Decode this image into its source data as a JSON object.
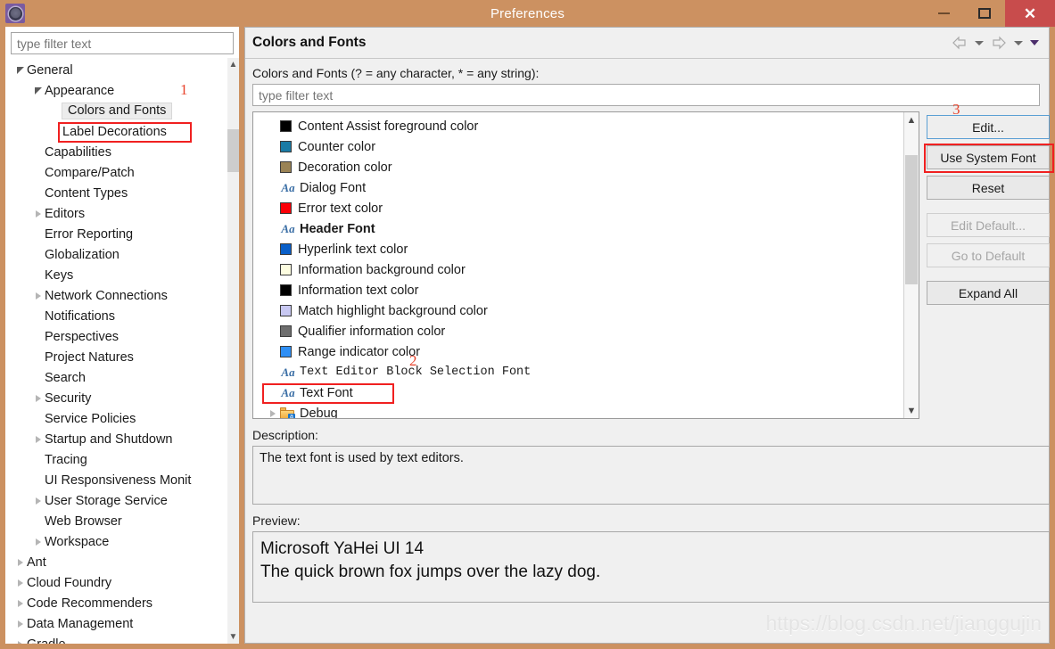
{
  "window": {
    "title": "Preferences",
    "app_icon": "gear-icon",
    "minimize_label": "–",
    "maximize_label": "☐",
    "close_label": "✕"
  },
  "sidebar": {
    "filter_placeholder": "type filter text",
    "filter_value": "",
    "items": [
      {
        "label": "General",
        "indent": 0,
        "twisty": "expanded"
      },
      {
        "label": "Appearance",
        "indent": 1,
        "twisty": "expanded"
      },
      {
        "label": "Colors and Fonts",
        "indent": 2,
        "twisty": "none",
        "selected": true
      },
      {
        "label": "Label Decorations",
        "indent": 2,
        "twisty": "none",
        "highlight": "red"
      },
      {
        "label": "Capabilities",
        "indent": 1,
        "twisty": "none"
      },
      {
        "label": "Compare/Patch",
        "indent": 1,
        "twisty": "none"
      },
      {
        "label": "Content Types",
        "indent": 1,
        "twisty": "none"
      },
      {
        "label": "Editors",
        "indent": 1,
        "twisty": "collapsed"
      },
      {
        "label": "Error Reporting",
        "indent": 1,
        "twisty": "none"
      },
      {
        "label": "Globalization",
        "indent": 1,
        "twisty": "none"
      },
      {
        "label": "Keys",
        "indent": 1,
        "twisty": "none"
      },
      {
        "label": "Network Connections",
        "indent": 1,
        "twisty": "collapsed"
      },
      {
        "label": "Notifications",
        "indent": 1,
        "twisty": "none"
      },
      {
        "label": "Perspectives",
        "indent": 1,
        "twisty": "none"
      },
      {
        "label": "Project Natures",
        "indent": 1,
        "twisty": "none"
      },
      {
        "label": "Search",
        "indent": 1,
        "twisty": "none"
      },
      {
        "label": "Security",
        "indent": 1,
        "twisty": "collapsed"
      },
      {
        "label": "Service Policies",
        "indent": 1,
        "twisty": "none"
      },
      {
        "label": "Startup and Shutdown",
        "indent": 1,
        "twisty": "collapsed"
      },
      {
        "label": "Tracing",
        "indent": 1,
        "twisty": "none"
      },
      {
        "label": "UI Responsiveness Monit",
        "indent": 1,
        "twisty": "none"
      },
      {
        "label": "User Storage Service",
        "indent": 1,
        "twisty": "collapsed"
      },
      {
        "label": "Web Browser",
        "indent": 1,
        "twisty": "none"
      },
      {
        "label": "Workspace",
        "indent": 1,
        "twisty": "collapsed"
      },
      {
        "label": "Ant",
        "indent": 0,
        "twisty": "collapsed"
      },
      {
        "label": "Cloud Foundry",
        "indent": 0,
        "twisty": "collapsed"
      },
      {
        "label": "Code Recommenders",
        "indent": 0,
        "twisty": "collapsed"
      },
      {
        "label": "Data Management",
        "indent": 0,
        "twisty": "collapsed"
      },
      {
        "label": "Gradle",
        "indent": 0,
        "twisty": "collapsed"
      }
    ]
  },
  "page": {
    "title": "Colors and Fonts",
    "filter_label": "Colors and Fonts (? = any character, * = any string):",
    "filter_placeholder": "type filter text",
    "filter_value": "",
    "nav": {
      "back_icon": "back-arrow-icon",
      "back_menu_icon": "chevron-down-icon",
      "forward_icon": "forward-arrow-icon",
      "forward_menu_icon": "chevron-down-icon",
      "overflow_menu_icon": "chevron-down-filled-icon"
    }
  },
  "color_list": [
    {
      "label": "Content Assist foreground color",
      "kind": "color",
      "color": "#000000"
    },
    {
      "label": "Counter color",
      "kind": "color",
      "color": "#1a7ba5"
    },
    {
      "label": "Decoration color",
      "kind": "color",
      "color": "#9a8355"
    },
    {
      "label": "Dialog Font",
      "kind": "font",
      "icon": "Aa"
    },
    {
      "label": "Error text color",
      "kind": "color",
      "color": "#fb0007"
    },
    {
      "label": "Header Font",
      "kind": "font",
      "icon": "Aa",
      "style": "bold"
    },
    {
      "label": "Hyperlink text color",
      "kind": "color",
      "color": "#0a5fc8"
    },
    {
      "label": "Information background color",
      "kind": "color",
      "color": "#fdfde0"
    },
    {
      "label": "Information text color",
      "kind": "color",
      "color": "#000000"
    },
    {
      "label": "Match highlight background color",
      "kind": "color",
      "color": "#c8c8f2"
    },
    {
      "label": "Qualifier information color",
      "kind": "color",
      "color": "#6e6e6e"
    },
    {
      "label": "Range indicator color",
      "kind": "color",
      "color": "#2f8ff5"
    },
    {
      "label": "Text Editor Block Selection Font",
      "kind": "font",
      "icon": "Aa",
      "style": "mono",
      "marker": "2"
    },
    {
      "label": "Text Font",
      "kind": "font",
      "icon": "Aa",
      "highlight": "red"
    },
    {
      "label": "Debug",
      "kind": "folder",
      "twisty": "collapsed"
    }
  ],
  "buttons": [
    {
      "label": "Edit...",
      "state": "focused",
      "marker": "3"
    },
    {
      "label": "Use System Font",
      "state": "normal",
      "highlight": "red"
    },
    {
      "label": "Reset",
      "state": "normal"
    },
    {
      "label": "Edit Default...",
      "state": "disabled",
      "gap": true
    },
    {
      "label": "Go to Default",
      "state": "disabled"
    },
    {
      "label": "Expand All",
      "state": "normal",
      "gap": true
    }
  ],
  "description": {
    "label": "Description:",
    "text": "The text font is used by text editors."
  },
  "preview": {
    "label": "Preview:",
    "line1": "Microsoft YaHei UI 14",
    "line2": "The quick brown fox jumps over the lazy dog."
  },
  "watermark": "https://blog.csdn.net/jianggujin",
  "annotations": {
    "one": "1",
    "two": "2",
    "three": "3"
  },
  "colors": {
    "titlebar": "#cc9161",
    "close_button": "#c84c4c",
    "annotation_red": "#f02020",
    "focus_blue": "#5a9fd4"
  }
}
